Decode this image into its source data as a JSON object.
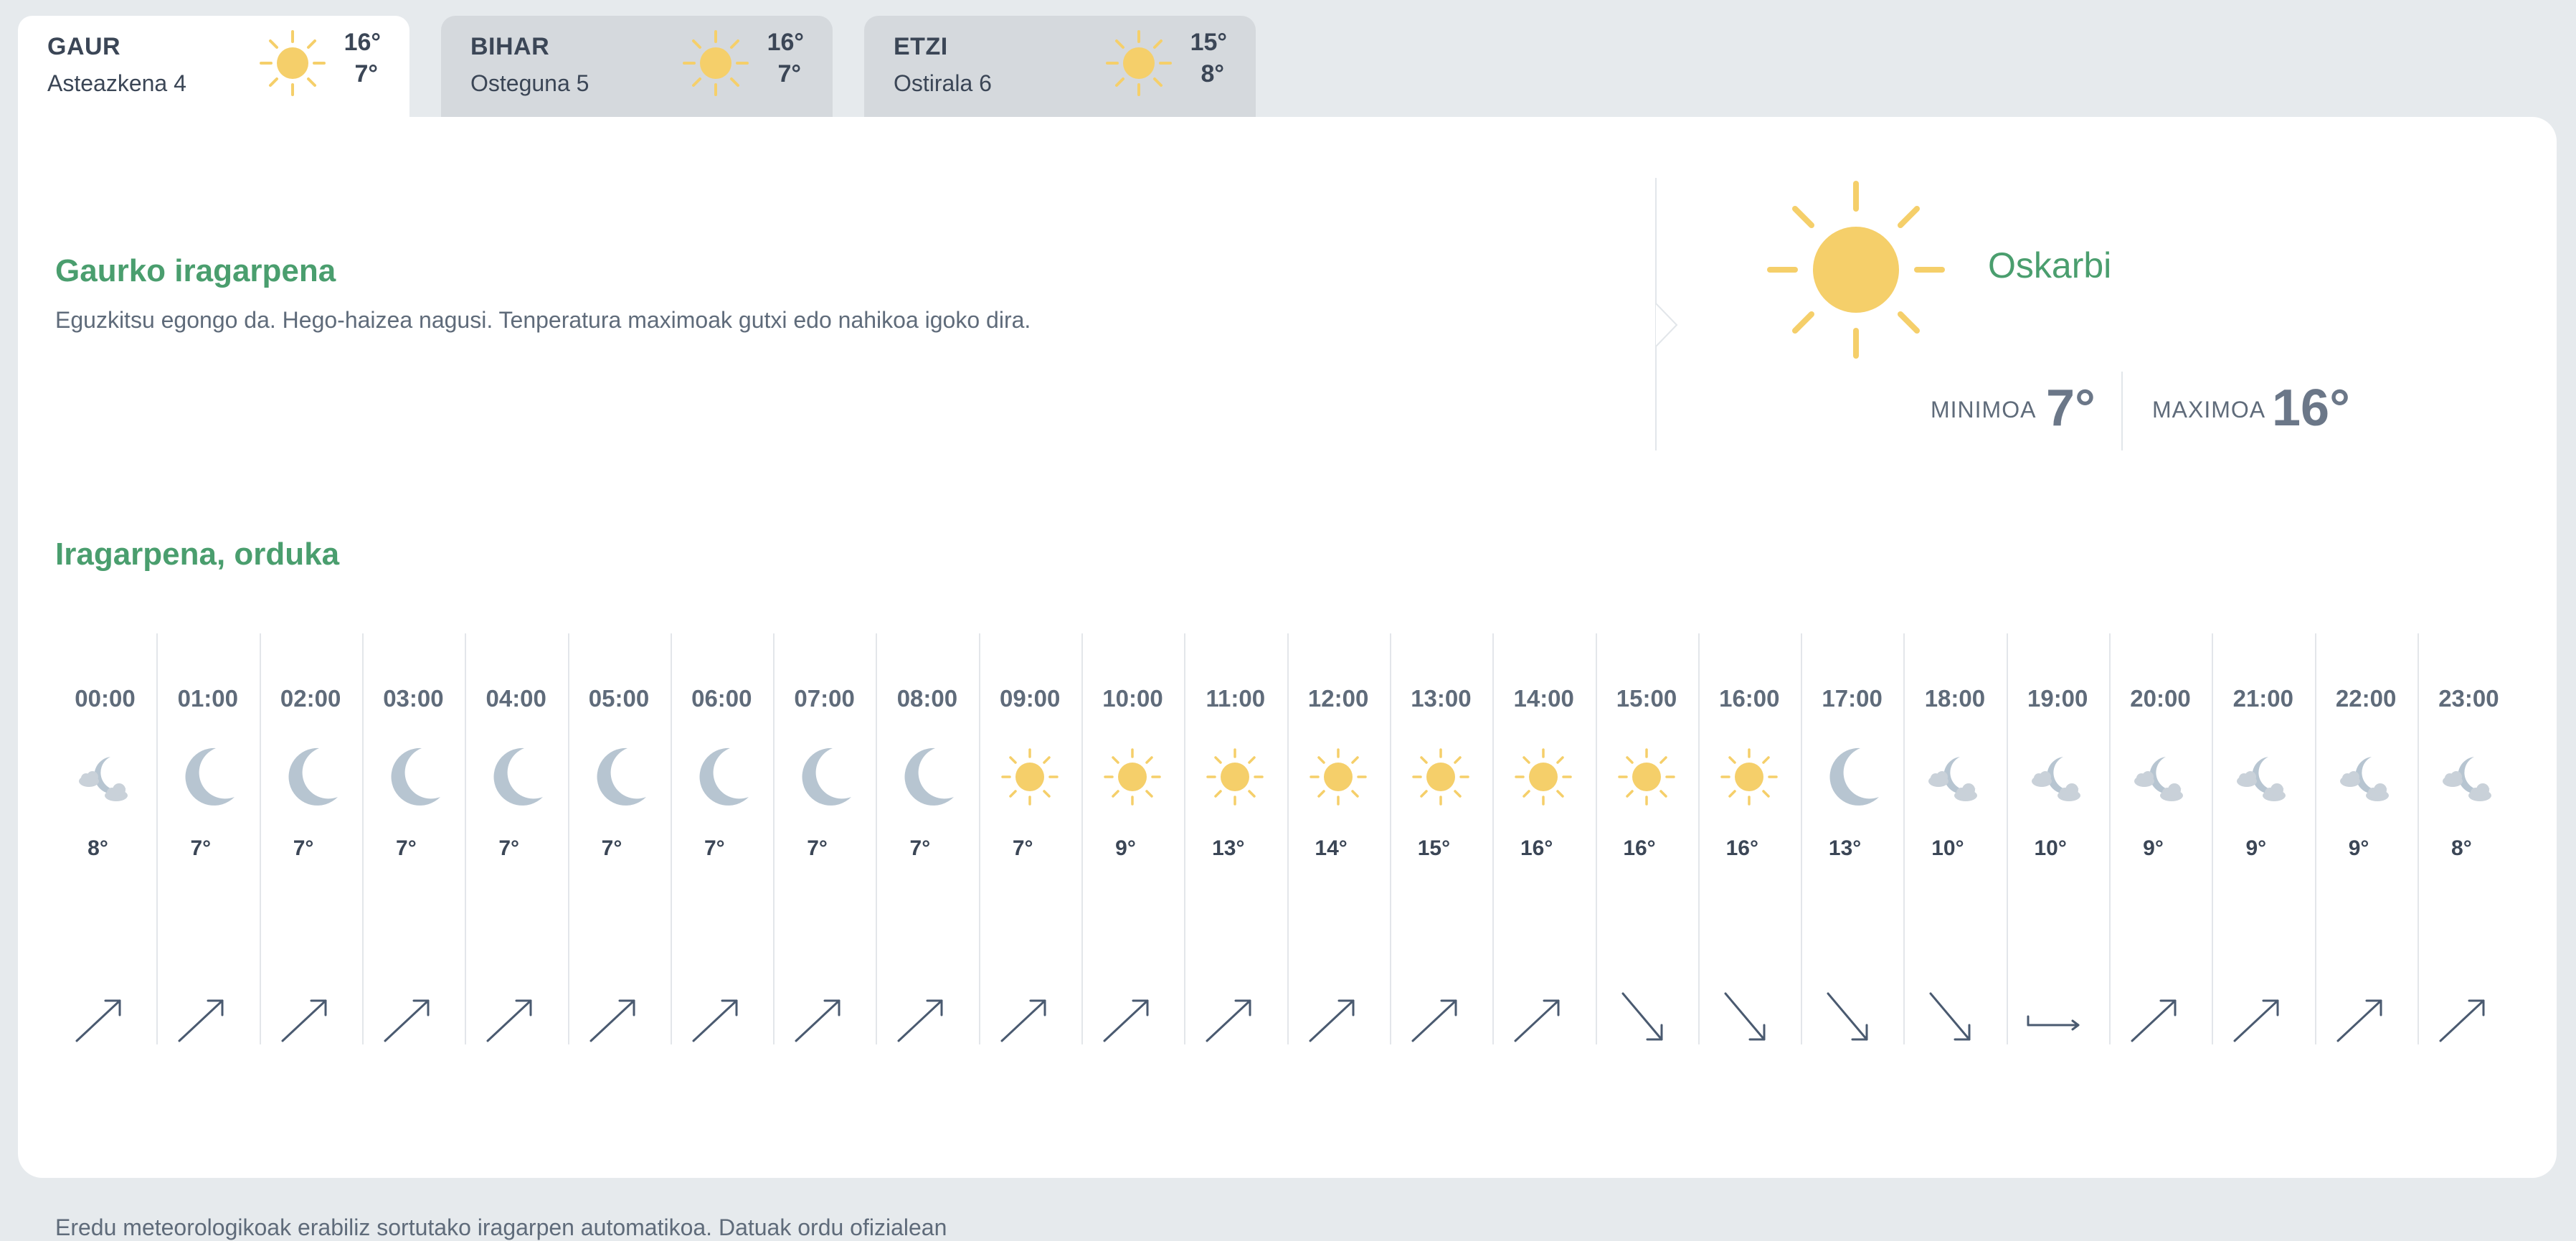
{
  "days": [
    {
      "name": "GAUR",
      "date": "Asteazkena 4",
      "max": "16°",
      "min": "7°",
      "icon": "sun-icon",
      "active": true
    },
    {
      "name": "BIHAR",
      "date": "Osteguna 5",
      "max": "16°",
      "min": "7°",
      "icon": "sun-icon",
      "active": false
    },
    {
      "name": "ETZI",
      "date": "Ostirala 6",
      "max": "15°",
      "min": "8°",
      "icon": "sun-icon",
      "active": false
    }
  ],
  "today": {
    "title": "Gaurko iragarpena",
    "text": "Eguzkitsu egongo da. Hego-haizea nagusi. Tenperatura maximoak gutxi edo nahikoa igoko dira.",
    "condition": "Oskarbi",
    "min_label": "MINIMOA",
    "min_value": "7°",
    "max_label": "MAXIMOA",
    "max_value": "16°"
  },
  "hourly": {
    "title": "Iragarpena, orduka",
    "hours": [
      {
        "time": "00:00",
        "icon": "moon-cloud",
        "temp": "8°",
        "wind": "ne"
      },
      {
        "time": "01:00",
        "icon": "moon",
        "temp": "7°",
        "wind": "ne"
      },
      {
        "time": "02:00",
        "icon": "moon",
        "temp": "7°",
        "wind": "ne"
      },
      {
        "time": "03:00",
        "icon": "moon",
        "temp": "7°",
        "wind": "ne"
      },
      {
        "time": "04:00",
        "icon": "moon",
        "temp": "7°",
        "wind": "ne"
      },
      {
        "time": "05:00",
        "icon": "moon",
        "temp": "7°",
        "wind": "ne"
      },
      {
        "time": "06:00",
        "icon": "moon",
        "temp": "7°",
        "wind": "ne"
      },
      {
        "time": "07:00",
        "icon": "moon",
        "temp": "7°",
        "wind": "ne"
      },
      {
        "time": "08:00",
        "icon": "moon",
        "temp": "7°",
        "wind": "ne"
      },
      {
        "time": "09:00",
        "icon": "sun",
        "temp": "7°",
        "wind": "ne"
      },
      {
        "time": "10:00",
        "icon": "sun",
        "temp": "9°",
        "wind": "ne"
      },
      {
        "time": "11:00",
        "icon": "sun",
        "temp": "13°",
        "wind": "ne"
      },
      {
        "time": "12:00",
        "icon": "sun",
        "temp": "14°",
        "wind": "ne"
      },
      {
        "time": "13:00",
        "icon": "sun",
        "temp": "15°",
        "wind": "ne"
      },
      {
        "time": "14:00",
        "icon": "sun",
        "temp": "16°",
        "wind": "ne"
      },
      {
        "time": "15:00",
        "icon": "sun",
        "temp": "16°",
        "wind": "se"
      },
      {
        "time": "16:00",
        "icon": "sun",
        "temp": "16°",
        "wind": "se"
      },
      {
        "time": "17:00",
        "icon": "moon",
        "temp": "13°",
        "wind": "se"
      },
      {
        "time": "18:00",
        "icon": "moon-cloud",
        "temp": "10°",
        "wind": "se"
      },
      {
        "time": "19:00",
        "icon": "moon-cloud",
        "temp": "10°",
        "wind": "e"
      },
      {
        "time": "20:00",
        "icon": "moon-cloud",
        "temp": "9°",
        "wind": "ne"
      },
      {
        "time": "21:00",
        "icon": "moon-cloud",
        "temp": "9°",
        "wind": "ne"
      },
      {
        "time": "22:00",
        "icon": "moon-cloud",
        "temp": "9°",
        "wind": "ne"
      },
      {
        "time": "23:00",
        "icon": "moon-cloud",
        "temp": "8°",
        "wind": "ne"
      }
    ]
  },
  "footer": "Eredu meteorologikoak erabiliz sortutako iragarpen automatikoa. Datuak ordu ofizialean",
  "colors": {
    "accent": "#4a9e6e",
    "sun": "#f5cf6a",
    "moon": "#b7c5d1",
    "cloud": "#c9d1d9",
    "wind_arrow": "#4a5a70"
  }
}
